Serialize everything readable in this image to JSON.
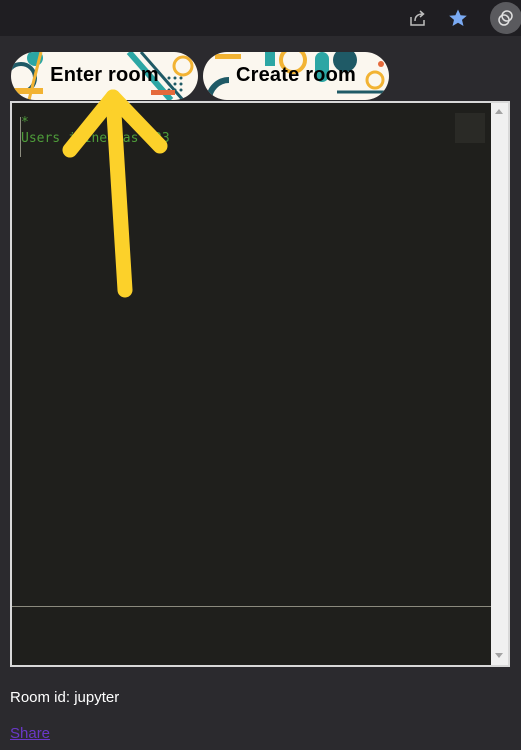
{
  "buttons": {
    "enter_label": "Enter room",
    "create_label": "Create room"
  },
  "editor": {
    "lines": [
      "*",
      "Users joined as 123"
    ],
    "text_color": "#4e9c3a",
    "background": "#1f1f1c"
  },
  "room": {
    "id_text": "Room id: jupyter"
  },
  "share_link": "Share",
  "icons": {
    "share": "share-icon",
    "bookmark": "star-icon",
    "profile": "profile-avatar-icon",
    "annotation": "yellow-arrow-icon"
  },
  "colors": {
    "arrow": "#fcd12a",
    "bookmark_star": "#7aaaf3",
    "link": "#6a38c8",
    "page_bg": "#2b2a2e"
  }
}
